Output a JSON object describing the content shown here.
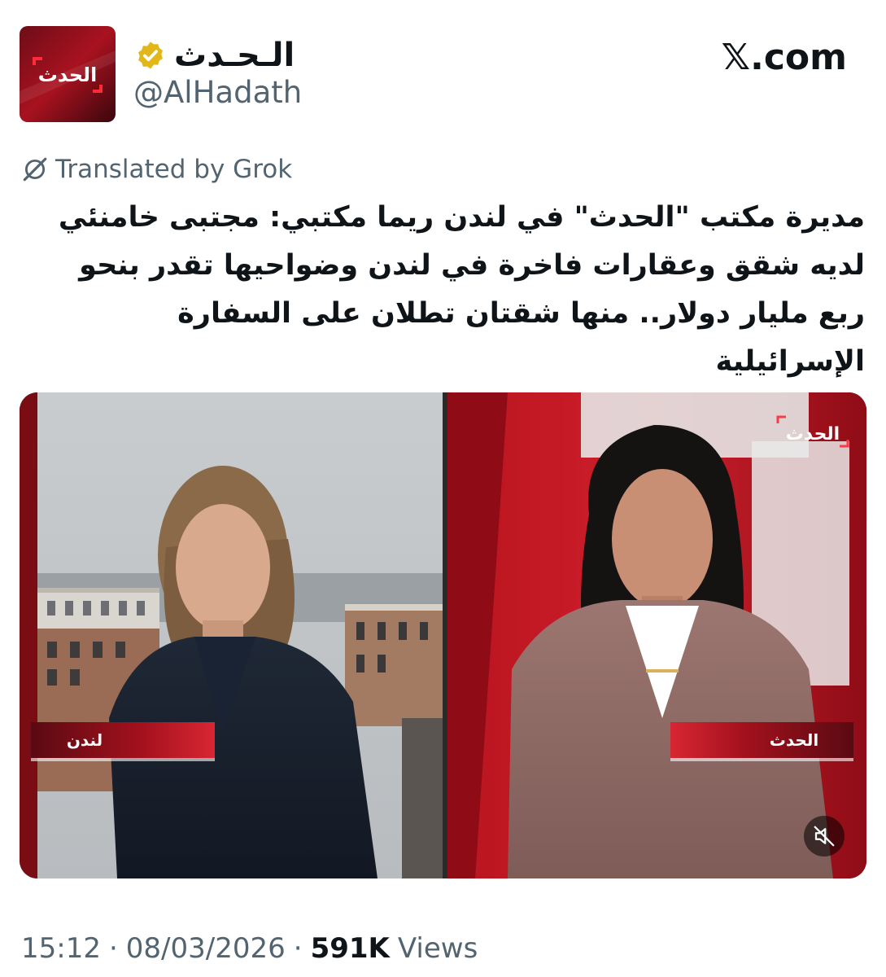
{
  "account": {
    "display_name": "الـحـدث",
    "handle": "@AlHadath",
    "avatar_text": "الحدث",
    "verified": true,
    "verified_color": "#e2b719"
  },
  "brand": {
    "label": "𝕏.com"
  },
  "translation": {
    "label": "Translated by Grok"
  },
  "tweet": {
    "text": "مديرة مكتب \"الحدث\" في لندن ريما مكتبي: مجتبى خامنئي لديه شقق وعقارات فاخرة في لندن وضواحيها تقدر بنحو ربع مليار دولار.. منها شقتان تطلان على السفارة الإسرائيلية"
  },
  "video": {
    "left_caption": "لندن",
    "right_caption": "الحدث",
    "channel_logo": "الحدث",
    "mute_icon": "speaker-muted-icon"
  },
  "footer": {
    "time": "15:12",
    "date": "08/03/2026",
    "separator": "·",
    "views_count": "591K",
    "views_label": "Views"
  },
  "colors": {
    "brand_red": "#c8102e",
    "secondary_text": "#536471",
    "primary_text": "#0f1419"
  }
}
